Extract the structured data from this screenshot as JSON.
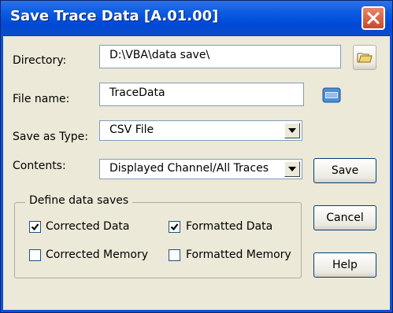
{
  "window": {
    "title": "Save Trace Data [A.01.00]"
  },
  "form": {
    "directory_label": "Directory:",
    "directory_value": "D:\\VBA\\data save\\",
    "filename_label": "File name:",
    "filename_value": "TraceData",
    "save_type_label": "Save as Type:",
    "save_type_value": "CSV File",
    "contents_label": "Contents:",
    "contents_value": "Displayed Channel/All Traces"
  },
  "group": {
    "title": "Define data saves",
    "options": [
      {
        "label": "Corrected Data",
        "checked": true
      },
      {
        "label": "Formatted Data",
        "checked": true
      },
      {
        "label": "Corrected Memory",
        "checked": false
      },
      {
        "label": "Formatted Memory",
        "checked": false
      }
    ]
  },
  "buttons": {
    "save": "Save",
    "cancel": "Cancel",
    "help": "Help"
  },
  "icons": {
    "close": "close-icon",
    "folder": "folder-icon",
    "keyboard": "keyboard-icon",
    "dropdown": "chevron-down-icon",
    "check": "checkmark-icon"
  },
  "colors": {
    "titlebar": "#0a5be0",
    "dialog_bg": "#ece9d8",
    "close_button": "#c9482a"
  }
}
